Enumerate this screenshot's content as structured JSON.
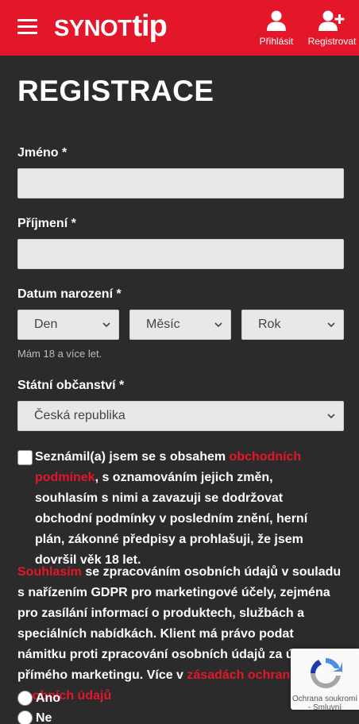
{
  "header": {
    "logo_synot": "SYNOT",
    "logo_tip": "tip",
    "login_label": "Přihlásit",
    "register_label": "Registrovat"
  },
  "form": {
    "title": "REGISTRACE",
    "first_name_label": "Jméno *",
    "last_name_label": "Příjmení *",
    "birth_date_label": "Datum narození *",
    "day_select": "Den",
    "month_select": "Měsíc",
    "year_select": "Rok",
    "age_hint": "Mám 18 a více let.",
    "citizenship_label": "Státní občanství *",
    "citizenship_value": "Česká republika",
    "terms": {
      "prefix": "Seznámil(a) jsem se s obsahem ",
      "link": "obchodních podmínek",
      "suffix": ", s oznamováním jejich změn, souhlasím s nimi a zavazuji se dodržovat obchodní podmínky v posledním znění, herní plán, zákonné předpisy a prohlašuji, že jsem dovršil věk 18 let."
    },
    "gdpr": {
      "link_start": "Souhlasím",
      "text": " se zpracováním osobních údajů v souladu s nařízením GDPR pro marketingové účely, zejména pro zasílání informací o produktech, službách a speciálních nabídkách. Klient má právo podat námitku proti zpracování osobních údajů za účelem přímého marketingu. Více v ",
      "link_end": "zásadách ochrany osobních údajů"
    },
    "radio_yes": "Ano",
    "radio_no": "Ne"
  },
  "recaptcha": {
    "line1": "Ochrana soukromí",
    "line2": "- Smluvní"
  },
  "colors": {
    "brand_red": "#e3162a",
    "background": "#2b2b2b",
    "input_bg": "#e8e8e8"
  },
  "icons": {
    "menu": "hamburger-icon",
    "login": "user-icon",
    "register": "user-plus-icon",
    "select": "chevron-down-icon",
    "captcha": "recaptcha-icon"
  }
}
